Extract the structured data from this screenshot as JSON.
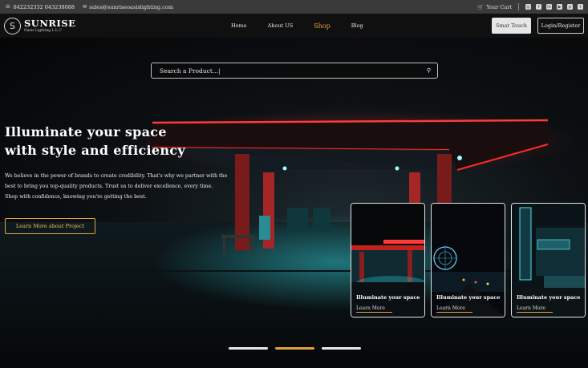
{
  "topbar": {
    "phone": "042232332 043238088",
    "email": "sales@sunriseoasislighting.com",
    "cart": "Your Cart",
    "socials": [
      "instagram-icon",
      "facebook-icon",
      "linkedin-icon",
      "youtube-icon",
      "pinterest-icon",
      "twitter-icon"
    ]
  },
  "brand": {
    "name": "SUNRISE",
    "sub": "Oasis Lighting L.L.C"
  },
  "nav": {
    "items": [
      {
        "label": "Home"
      },
      {
        "label": "About US"
      },
      {
        "label": "Shop",
        "active": true
      },
      {
        "label": "Blog"
      }
    ],
    "smart_touch": "Smat Touch",
    "login": "Login/Register"
  },
  "search": {
    "placeholder": "Search a Product...|"
  },
  "hero": {
    "headline_1": "Illuminate your space",
    "headline_2": "with style and efficiency",
    "paragraph_1": "We believe in the power of brands to create credibility. That's why we partner with the",
    "paragraph_2": "best to bring you top-quality products. Trust us to deliver excellence, every time.",
    "paragraph_3": "Shop with confidence, knowing you're getting the best.",
    "cta": "Learn More about Project"
  },
  "cards": [
    {
      "title": "Illuminate your space",
      "link": "Learn More"
    },
    {
      "title": "Illuminate your space",
      "link": "Learn More"
    },
    {
      "title": "Illuminate your space",
      "link": "Learn More"
    }
  ],
  "slider": {
    "count": 3,
    "active_index": 1
  },
  "colors": {
    "accent": "#e2a23b",
    "neon_red": "#ff2a2a",
    "teal": "#2ec4cc"
  }
}
